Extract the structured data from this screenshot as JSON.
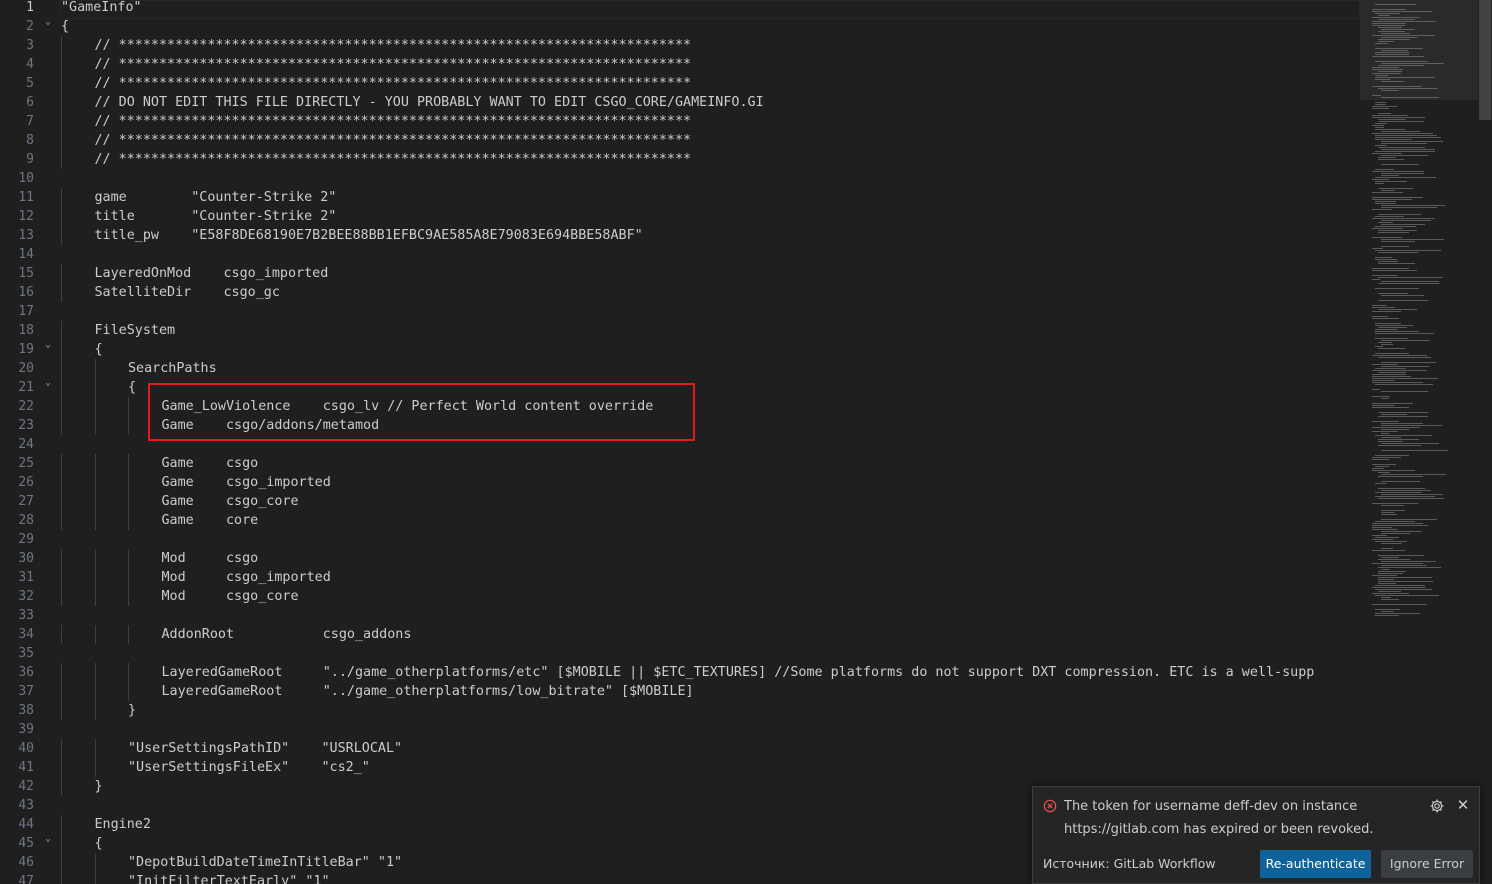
{
  "editor": {
    "lines": [
      {
        "n": "1",
        "text": "\"GameInfo\"",
        "indent": 0,
        "fold": false,
        "active": true
      },
      {
        "n": "2",
        "text": "{",
        "indent": 0,
        "fold": true
      },
      {
        "n": "3",
        "text": "// ***********************************************************************",
        "indent": 1
      },
      {
        "n": "4",
        "text": "// ***********************************************************************",
        "indent": 1
      },
      {
        "n": "5",
        "text": "// ***********************************************************************",
        "indent": 1
      },
      {
        "n": "6",
        "text": "// DO NOT EDIT THIS FILE DIRECTLY - YOU PROBABLY WANT TO EDIT CSGO_CORE/GAMEINFO.GI",
        "indent": 1
      },
      {
        "n": "7",
        "text": "// ***********************************************************************",
        "indent": 1
      },
      {
        "n": "8",
        "text": "// ***********************************************************************",
        "indent": 1
      },
      {
        "n": "9",
        "text": "// ***********************************************************************",
        "indent": 1
      },
      {
        "n": "10",
        "text": "",
        "indent": 0
      },
      {
        "n": "11",
        "text": "game        \"Counter-Strike 2\"",
        "indent": 1
      },
      {
        "n": "12",
        "text": "title       \"Counter-Strike 2\"",
        "indent": 1
      },
      {
        "n": "13",
        "text": "title_pw    \"E58F8DE68190E7B2BEE88BB1EFBC9AE585A8E79083E694BBE58ABF\"",
        "indent": 1
      },
      {
        "n": "14",
        "text": "",
        "indent": 0
      },
      {
        "n": "15",
        "text": "LayeredOnMod    csgo_imported",
        "indent": 1
      },
      {
        "n": "16",
        "text": "SatelliteDir    csgo_gc",
        "indent": 1
      },
      {
        "n": "17",
        "text": "",
        "indent": 0
      },
      {
        "n": "18",
        "text": "FileSystem",
        "indent": 1
      },
      {
        "n": "19",
        "text": "{",
        "indent": 1,
        "fold": true
      },
      {
        "n": "20",
        "text": "SearchPaths",
        "indent": 2
      },
      {
        "n": "21",
        "text": "{",
        "indent": 2,
        "fold": true
      },
      {
        "n": "22",
        "text": "Game_LowViolence    csgo_lv // Perfect World content override",
        "indent": 3
      },
      {
        "n": "23",
        "text": "Game    csgo/addons/metamod",
        "indent": 3
      },
      {
        "n": "24",
        "text": "",
        "indent": 0
      },
      {
        "n": "25",
        "text": "Game    csgo",
        "indent": 3
      },
      {
        "n": "26",
        "text": "Game    csgo_imported",
        "indent": 3
      },
      {
        "n": "27",
        "text": "Game    csgo_core",
        "indent": 3
      },
      {
        "n": "28",
        "text": "Game    core",
        "indent": 3
      },
      {
        "n": "29",
        "text": "",
        "indent": 0
      },
      {
        "n": "30",
        "text": "Mod     csgo",
        "indent": 3
      },
      {
        "n": "31",
        "text": "Mod     csgo_imported",
        "indent": 3
      },
      {
        "n": "32",
        "text": "Mod     csgo_core",
        "indent": 3
      },
      {
        "n": "33",
        "text": "",
        "indent": 0
      },
      {
        "n": "34",
        "text": "AddonRoot           csgo_addons",
        "indent": 3
      },
      {
        "n": "35",
        "text": "",
        "indent": 0
      },
      {
        "n": "36",
        "text": "LayeredGameRoot     \"../game_otherplatforms/etc\" [$MOBILE || $ETC_TEXTURES] //Some platforms do not support DXT compression. ETC is a well-supp",
        "indent": 3
      },
      {
        "n": "37",
        "text": "LayeredGameRoot     \"../game_otherplatforms/low_bitrate\" [$MOBILE]",
        "indent": 3
      },
      {
        "n": "38",
        "text": "}",
        "indent": 2
      },
      {
        "n": "39",
        "text": "",
        "indent": 0
      },
      {
        "n": "40",
        "text": "\"UserSettingsPathID\"    \"USRLOCAL\"",
        "indent": 2
      },
      {
        "n": "41",
        "text": "\"UserSettingsFileEx\"    \"cs2_\"",
        "indent": 2
      },
      {
        "n": "42",
        "text": "}",
        "indent": 1
      },
      {
        "n": "43",
        "text": "",
        "indent": 0
      },
      {
        "n": "44",
        "text": "Engine2",
        "indent": 1
      },
      {
        "n": "45",
        "text": "{",
        "indent": 1,
        "fold": true
      },
      {
        "n": "46",
        "text": "\"DepotBuildDateTimeInTitleBar\" \"1\"",
        "indent": 2
      },
      {
        "n": "47",
        "text": "\"InitFilterTextEarly\" \"1\"",
        "indent": 2
      }
    ]
  },
  "notification": {
    "message_line1": "The token for username deff-dev on instance",
    "message_line2": "https://gitlab.com has expired or been revoked.",
    "source": "Источник: GitLab Workflow",
    "primary_button": "Re-authenticate",
    "secondary_button": "Ignore Error",
    "icons": {
      "error": "error-circle-icon",
      "settings": "gear-icon",
      "close": "close-icon"
    },
    "colors": {
      "error": "#f14c4c",
      "primary": "#0e639c",
      "highlight_box": "#e51a1a"
    }
  }
}
